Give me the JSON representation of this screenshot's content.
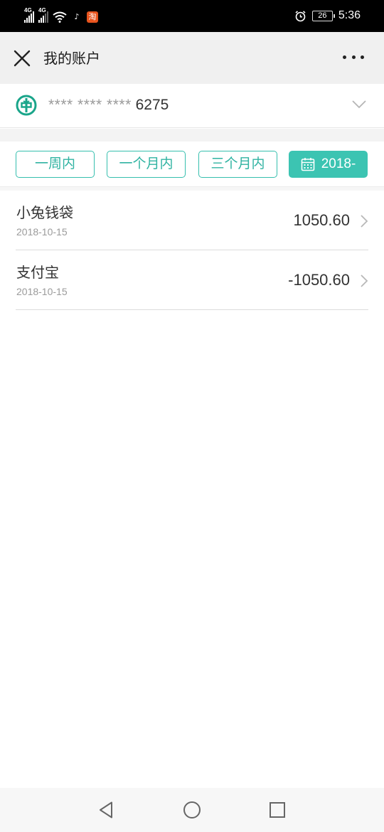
{
  "status_bar": {
    "network_1": "4G",
    "network_2": "4G",
    "app_1": "♪",
    "app_2": "淘",
    "battery": "26",
    "time": "5:36",
    "colors": {
      "app_1": "#000000",
      "app_2": "#e8541e"
    }
  },
  "header": {
    "title": "我的账户"
  },
  "account": {
    "masked_prefix": "**** **** ****",
    "last_digits": "6275"
  },
  "filters": [
    {
      "label": "一周内"
    },
    {
      "label": "一个月内"
    },
    {
      "label": "三个月内"
    },
    {
      "label": "2018-",
      "active": true
    }
  ],
  "transactions": [
    {
      "name": "小兔钱袋",
      "date": "2018-10-15",
      "amount": "1050.60"
    },
    {
      "name": "支付宝",
      "date": "2018-10-15",
      "amount": "-1050.60"
    }
  ],
  "theme": {
    "accent": "#3cc4b2",
    "bank_green": "#1aa58a"
  }
}
